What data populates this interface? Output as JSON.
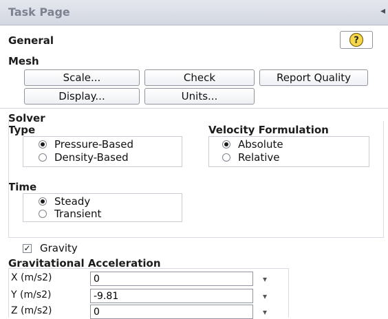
{
  "panel": {
    "title": "Task Page",
    "pin_glyph": "◂"
  },
  "general": {
    "heading": "General",
    "help_icon": "?"
  },
  "mesh": {
    "heading": "Mesh",
    "buttons": {
      "scale": "Scale...",
      "check": "Check",
      "report_quality": "Report Quality",
      "display": "Display...",
      "units": "Units..."
    }
  },
  "solver": {
    "heading": "Solver",
    "type": {
      "heading": "Type",
      "options": [
        "Pressure-Based",
        "Density-Based"
      ],
      "selected": "Pressure-Based"
    },
    "velocity": {
      "heading": "Velocity Formulation",
      "options": [
        "Absolute",
        "Relative"
      ],
      "selected": "Absolute"
    },
    "time": {
      "heading": "Time",
      "options": [
        "Steady",
        "Transient"
      ],
      "selected": "Steady"
    }
  },
  "gravity": {
    "label": "Gravity",
    "checked": true,
    "check_glyph": "✓"
  },
  "grav_accel": {
    "heading": "Gravitational Acceleration",
    "fields": [
      {
        "label": "X (m/s2)",
        "value": "0"
      },
      {
        "label": "Y (m/s2)",
        "value": "-9.81"
      },
      {
        "label": "Z (m/s2)",
        "value": "0"
      }
    ],
    "dropdown_glyph": "▾"
  }
}
